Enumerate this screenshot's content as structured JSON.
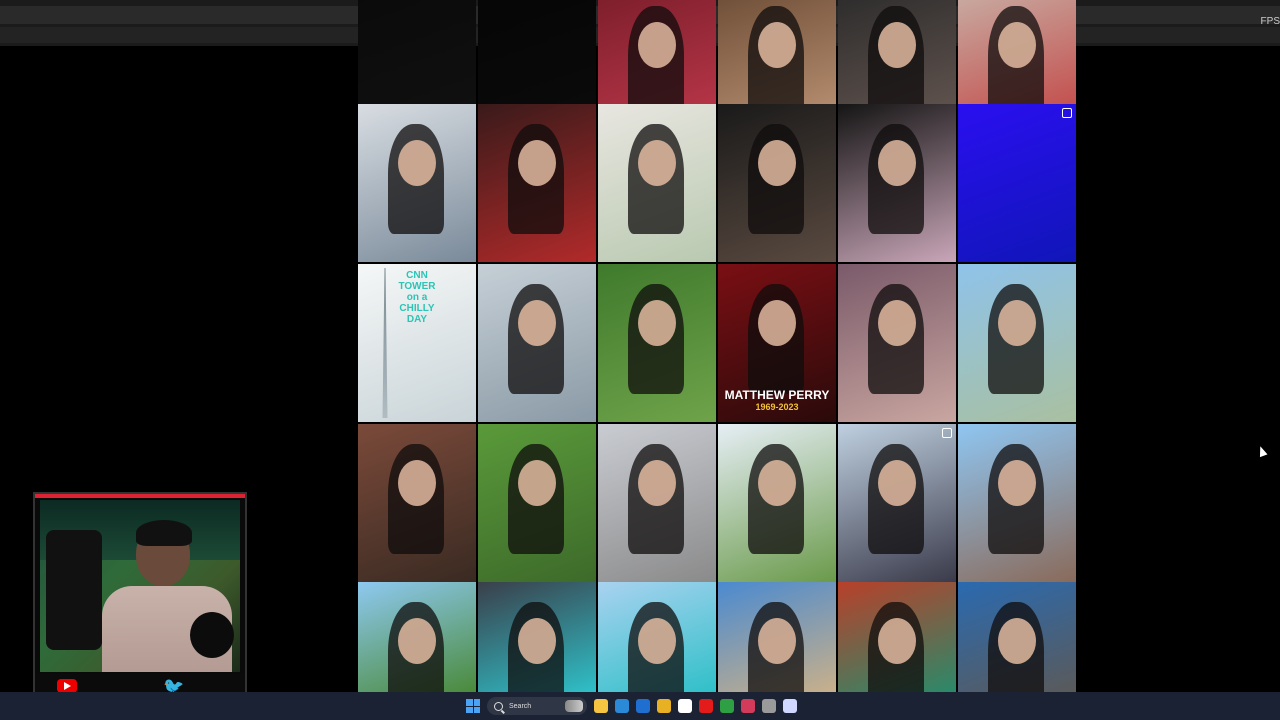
{
  "overlay": {
    "fps_label": "FPS"
  },
  "grid": {
    "tiles": [
      {
        "id": "r0c0",
        "colors": [
          "#0a0a0a",
          "#111111"
        ]
      },
      {
        "id": "r0c1",
        "colors": [
          "#050505",
          "#0b0b0b"
        ]
      },
      {
        "id": "r0c2",
        "colors": [
          "#7a1d2a",
          "#c23a4d"
        ]
      },
      {
        "id": "r0c3",
        "colors": [
          "#6b4b35",
          "#c49a7a"
        ]
      },
      {
        "id": "r0c4",
        "colors": [
          "#2a2a2a",
          "#6b5b55"
        ]
      },
      {
        "id": "r0c5",
        "colors": [
          "#c8b0a6",
          "#c33a3a"
        ]
      },
      {
        "id": "r1c0",
        "colors": [
          "#d8dde2",
          "#7a8a9a"
        ]
      },
      {
        "id": "r1c1",
        "colors": [
          "#3a1a1a",
          "#b22a2a"
        ]
      },
      {
        "id": "r1c2",
        "colors": [
          "#e8e6e0",
          "#b9c9b0"
        ]
      },
      {
        "id": "r1c3",
        "colors": [
          "#1a1a1a",
          "#5a4a40"
        ]
      },
      {
        "id": "r1c4",
        "colors": [
          "#151515",
          "#c9a6b8"
        ]
      },
      {
        "id": "r1c5",
        "colors": [
          "#2a0ff0",
          "#1016b8"
        ],
        "reel": true
      },
      {
        "id": "r2c0",
        "colors": [
          "#f5f7f7",
          "#c9d4d8"
        ],
        "text_lines": [
          "CNN",
          "TOWER",
          "on a",
          "CHILLY",
          "DAY"
        ]
      },
      {
        "id": "r2c1",
        "colors": [
          "#c6cfd6",
          "#8a9aa6"
        ]
      },
      {
        "id": "r2c2",
        "colors": [
          "#3f7a2c",
          "#6fa34a"
        ]
      },
      {
        "id": "r2c3",
        "colors": [
          "#7a0f14",
          "#2a0a0a"
        ],
        "name": "MATTHEW PERRY",
        "years": "1969-2023"
      },
      {
        "id": "r2c4",
        "colors": [
          "#7a5a6a",
          "#c9a6a0"
        ]
      },
      {
        "id": "r2c5",
        "colors": [
          "#8fc3ea",
          "#a9c0a0"
        ]
      },
      {
        "id": "r3c0",
        "colors": [
          "#7a4a3a",
          "#3a2a22"
        ]
      },
      {
        "id": "r3c1",
        "colors": [
          "#5a9a3a",
          "#3d6a2a"
        ]
      },
      {
        "id": "r3c2",
        "colors": [
          "#c9ccd2",
          "#8a8a8a"
        ]
      },
      {
        "id": "r3c3",
        "colors": [
          "#e6eef5",
          "#6a9a4a"
        ]
      },
      {
        "id": "r3c4",
        "colors": [
          "#bfd0e0",
          "#3a3a4a"
        ],
        "reel": true
      },
      {
        "id": "r3c5",
        "colors": [
          "#8fc6f2",
          "#8a6a5a"
        ]
      },
      {
        "id": "r4c0",
        "colors": [
          "#8ec9f0",
          "#4a8a3a"
        ]
      },
      {
        "id": "r4c1",
        "colors": [
          "#3a3f4a",
          "#2fc0c8"
        ]
      },
      {
        "id": "r4c2",
        "colors": [
          "#a9d2f0",
          "#2fc0c8"
        ]
      },
      {
        "id": "r4c3",
        "colors": [
          "#4a8ad0",
          "#c9b08a"
        ]
      },
      {
        "id": "r4c4",
        "colors": [
          "#b8402a",
          "#2a8a6a"
        ]
      },
      {
        "id": "r4c5",
        "colors": [
          "#2a6ab0",
          "#5a5a5a"
        ]
      }
    ]
  },
  "taskbar": {
    "search_placeholder": "Search",
    "apps": [
      {
        "icon": "file-explorer-icon",
        "color": "#f5c542"
      },
      {
        "icon": "edge-icon",
        "color": "#2a8ad8"
      },
      {
        "icon": "outlook-icon",
        "color": "#1f6fd0"
      },
      {
        "icon": "chrome-icon",
        "color": "#e8b023"
      },
      {
        "icon": "calendar-icon",
        "color": "#ffffff"
      },
      {
        "icon": "youtube-icon",
        "color": "#e31b1b"
      },
      {
        "icon": "xbox-icon",
        "color": "#2ea043"
      },
      {
        "icon": "media-player-icon",
        "color": "#d23c5a"
      },
      {
        "icon": "app-icon",
        "color": "#9a9a9a"
      },
      {
        "icon": "sparkle-icon",
        "color": "#d0d8ff"
      }
    ]
  },
  "webcam": {
    "brand": {
      "youtube": "youtube-icon",
      "twitter": "twitter-icon"
    }
  }
}
